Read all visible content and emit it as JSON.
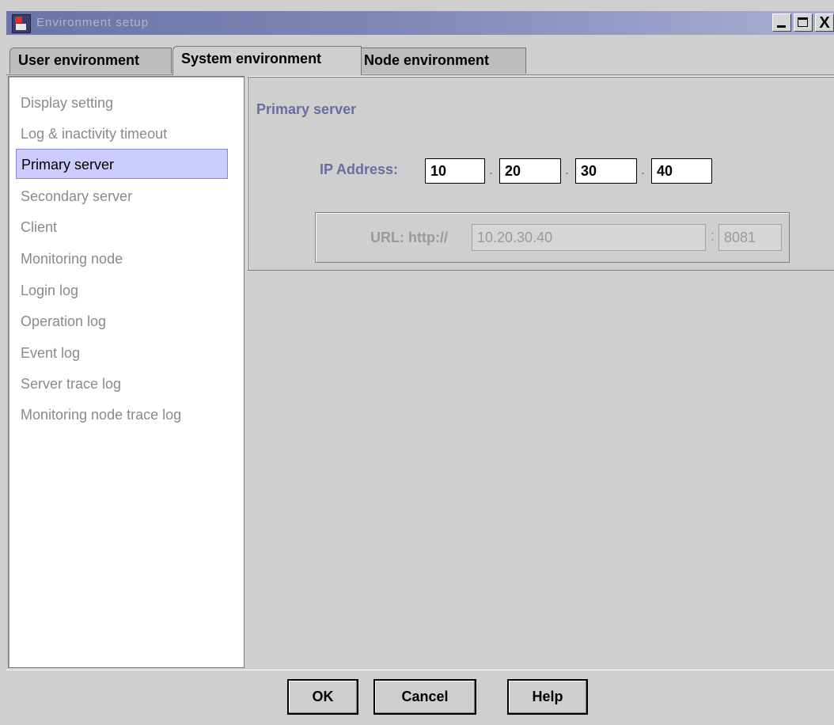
{
  "window": {
    "title": "Environment setup",
    "controls": [
      "minimize-icon",
      "maximize-icon",
      "close-icon"
    ],
    "close_glyph": "X"
  },
  "tabs": [
    {
      "label": "User environment",
      "active": false
    },
    {
      "label": "System environment",
      "active": true
    },
    {
      "label": "Node environment",
      "active": false
    }
  ],
  "sidebar": {
    "selected_index": 2,
    "items": [
      {
        "label": "Display setting"
      },
      {
        "label": "Log & inactivity timeout"
      },
      {
        "label": "Primary server"
      },
      {
        "label": "Secondary server"
      },
      {
        "label": "Client"
      },
      {
        "label": "Monitoring node"
      },
      {
        "label": "Login log"
      },
      {
        "label": "Operation log"
      },
      {
        "label": "Event log"
      },
      {
        "label": "Server trace log"
      },
      {
        "label": "Monitoring node trace log"
      }
    ]
  },
  "detail": {
    "section_title": "Primary server",
    "ip_label": "IP Address:",
    "ip_octets": [
      "10",
      "20",
      "30",
      "40"
    ],
    "dot": ".",
    "url_label": "URL:  http://",
    "url_host": "10.20.30.40",
    "url_colon": ":",
    "url_port": "8081"
  },
  "buttons": {
    "ok": "OK",
    "cancel": "Cancel",
    "help": "Help"
  },
  "colors": {
    "title_gradient_start": "#6a74a8",
    "label_accent": "#6a6e9e",
    "selection_bg": "#ccccff",
    "disabled_text": "#9a9a9a"
  }
}
